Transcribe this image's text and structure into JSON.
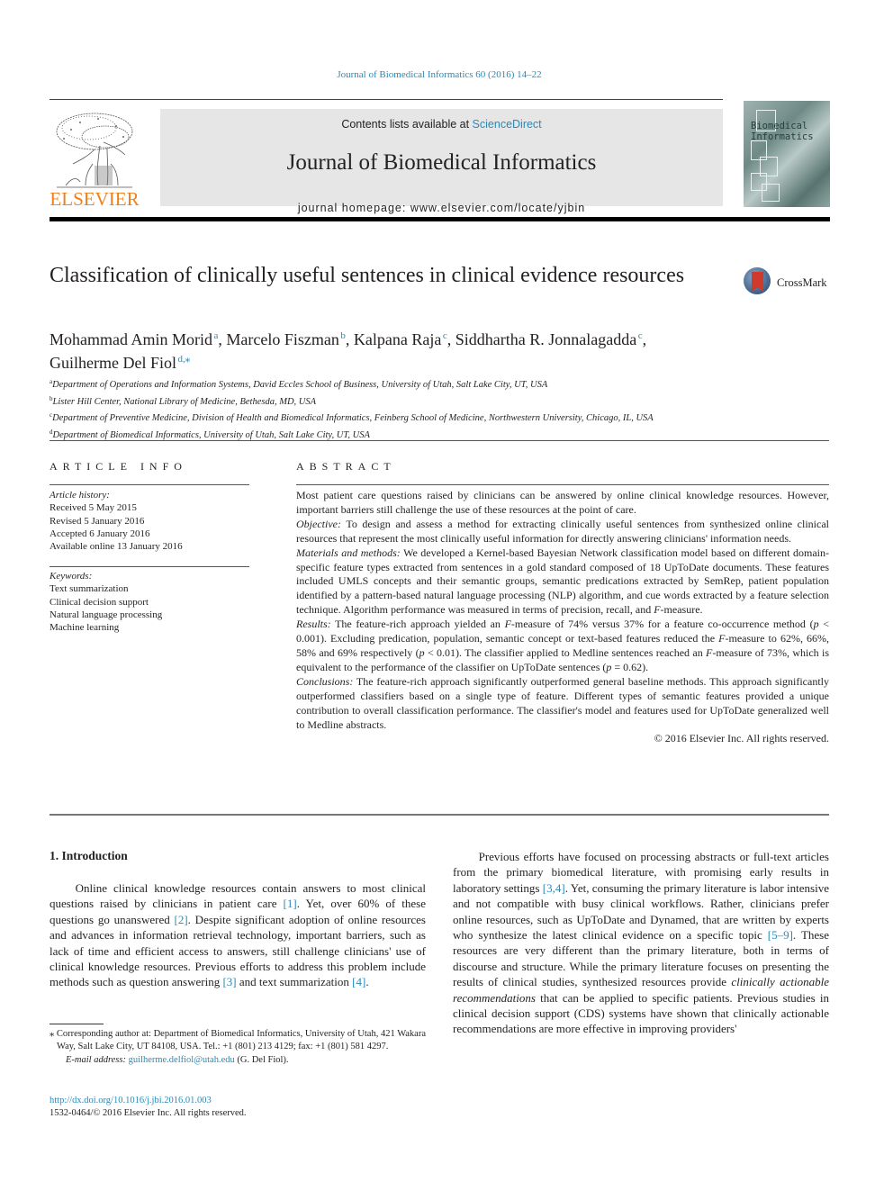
{
  "running_head": "Journal of Biomedical Informatics 60 (2016) 14–22",
  "masthead": {
    "publisher": "ELSEVIER",
    "contents_prefix": "Contents lists available at ",
    "contents_link": "ScienceDirect",
    "journal_title": "Journal of Biomedical Informatics",
    "homepage": "journal homepage: www.elsevier.com/locate/yjbin",
    "cover_text_line1": "Biomedical",
    "cover_text_line2": "Informatics",
    "brand_color": "#f07f1c",
    "link_color": "#2a8ab8"
  },
  "article": {
    "title": "Classification of clinically useful sentences in clinical evidence resources",
    "crossmark_label": "CrossMark",
    "authors": [
      {
        "name": "Mohammad Amin Morid",
        "sup": "a",
        "sep": ", "
      },
      {
        "name": "Marcelo Fiszman",
        "sup": "b",
        "sep": ", "
      },
      {
        "name": "Kalpana Raja",
        "sup": "c",
        "sep": ", "
      },
      {
        "name": "Siddhartha R. Jonnalagadda",
        "sup": "c",
        "sep": ","
      },
      {
        "name": "Guilherme Del Fiol",
        "sup": "d,⁎",
        "sep": ""
      }
    ],
    "affiliations": [
      {
        "key": "a",
        "text": "Department of Operations and Information Systems, David Eccles School of Business, University of Utah, Salt Lake City, UT, USA"
      },
      {
        "key": "b",
        "text": "Lister Hill Center, National Library of Medicine, Bethesda, MD, USA"
      },
      {
        "key": "c",
        "text": "Department of Preventive Medicine, Division of Health and Biomedical Informatics, Feinberg School of Medicine, Northwestern University, Chicago, IL, USA"
      },
      {
        "key": "d",
        "text": "Department of Biomedical Informatics, University of Utah, Salt Lake City, UT, USA"
      }
    ]
  },
  "article_info": {
    "heading": "ARTICLE INFO",
    "history_label": "Article history:",
    "history": [
      "Received 5 May 2015",
      "Revised 5 January 2016",
      "Accepted 6 January 2016",
      "Available online 13 January 2016"
    ],
    "keywords_label": "Keywords:",
    "keywords": [
      "Text summarization",
      "Clinical decision support",
      "Natural language processing",
      "Machine learning"
    ]
  },
  "abstract": {
    "heading": "ABSTRACT",
    "intro": "Most patient care questions raised by clinicians can be answered by online clinical knowledge resources. However, important barriers still challenge the use of these resources at the point of care.",
    "objective_label": "Objective:",
    "objective": " To design and assess a method for extracting clinically useful sentences from synthesized online clinical resources that represent the most clinically useful information for directly answering clinicians' information needs.",
    "methods_label": "Materials and methods:",
    "methods_a": " We developed a Kernel-based Bayesian Network classification model based on different domain-specific feature types extracted from sentences in a gold standard composed of 18 UpToDate documents. These features included UMLS concepts and their semantic groups, semantic predications extracted by SemRep, patient population identified by a pattern-based natural language processing (NLP) algorithm, and cue words extracted by a feature selection technique. Algorithm performance was measured in terms of precision, recall, and ",
    "methods_f": "F",
    "methods_b": "-measure.",
    "results_label": "Results:",
    "results_1": " The feature-rich approach yielded an ",
    "results_f1": "F",
    "results_2": "-measure of 74% versus 37% for a feature co-occurrence method (",
    "results_p1": "p",
    "results_3": " < 0.001). Excluding predication, population, semantic concept or text-based features reduced the ",
    "results_f2": "F",
    "results_4": "-measure to 62%, 66%, 58% and 69% respectively (",
    "results_p2": "p",
    "results_5": " < 0.01). The classifier applied to Medline sentences reached an ",
    "results_f3": "F",
    "results_6": "-measure of 73%, which is equivalent to the performance of the classifier on UpToDate sentences (",
    "results_p3": "p",
    "results_7": " = 0.62).",
    "conclusions_label": "Conclusions:",
    "conclusions": " The feature-rich approach significantly outperformed general baseline methods. This approach significantly outperformed classifiers based on a single type of feature. Different types of semantic features provided a unique contribution to overall classification performance. The classifier's model and features used for UpToDate generalized well to Medline abstracts.",
    "copyright": "© 2016 Elsevier Inc. All rights reserved."
  },
  "introduction": {
    "heading": "1. Introduction",
    "p1_a": "Online clinical knowledge resources contain answers to most clinical questions raised by clinicians in patient care ",
    "ref1": "[1]",
    "p1_b": ". Yet, over 60% of these questions go unanswered ",
    "ref2": "[2]",
    "p1_c": ". Despite significant adoption of online resources and advances in information retrieval technology, important barriers, such as lack of time and efficient access to answers, still challenge clinicians' use of clinical knowledge resources. Previous efforts to address this problem include methods such as question answering ",
    "ref3": "[3]",
    "p1_d": " and text summarization ",
    "ref4": "[4]",
    "p1_e": ".",
    "p2_a": "Previous efforts have focused on processing abstracts or full-text articles from the primary biomedical literature, with promising early results in laboratory settings ",
    "ref34": "[3,4]",
    "p2_b": ". Yet, consuming the primary literature is labor intensive and not compatible with busy clinical workflows. Rather, clinicians prefer online resources, such as UpToDate and Dynamed, that are written by experts who synthesize the latest clinical evidence on a specific topic ",
    "ref59": "[5–9]",
    "p2_c": ". These resources are very different than the primary literature, both in terms of discourse and structure. While the primary literature focuses on presenting the results of clinical studies, synthesized resources provide ",
    "p2_em": "clinically actionable recommendations",
    "p2_d": " that can be applied to specific patients. Previous studies in clinical decision support (CDS) systems have shown that clinically actionable recommendations are more effective in improving providers'"
  },
  "footnote": {
    "corresponding": "⁎ Corresponding author at: Department of Biomedical Informatics, University of Utah, 421 Wakara Way, Salt Lake City, UT 84108, USA. Tel.: +1 (801) 213 4129; fax: +1 (801) 581 4297.",
    "email_label": "E-mail address:",
    "email": "guilherme.delfiol@utah.edu",
    "email_suffix": " (G. Del Fiol).",
    "doi": "http://dx.doi.org/10.1016/j.jbi.2016.01.003",
    "issn": "1532-0464/© 2016 Elsevier Inc. All rights reserved."
  }
}
